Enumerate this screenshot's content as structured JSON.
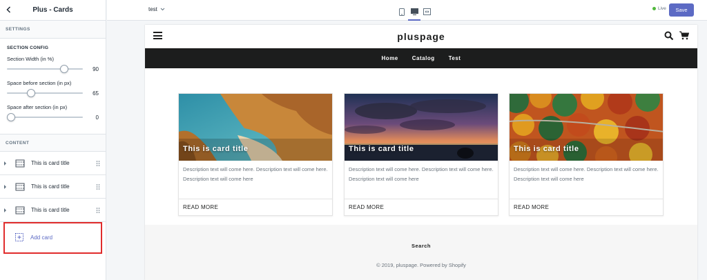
{
  "sidebar": {
    "title": "Plus - Cards",
    "settings_label": "SETTINGS",
    "section_config_label": "SECTION CONFIG",
    "fields": [
      {
        "label": "Section Width (in %)",
        "value": "90",
        "fraction": 0.79
      },
      {
        "label": "Space before section (in px)",
        "value": "65",
        "fraction": 0.3
      },
      {
        "label": "Space after section (in px)",
        "value": "0",
        "fraction": 0.0
      }
    ],
    "content_label": "CONTENT",
    "blocks": [
      {
        "label": "This is card title"
      },
      {
        "label": "This is card title"
      },
      {
        "label": "This is card title"
      }
    ],
    "add_card_label": "Add card"
  },
  "topbar": {
    "theme_name": "test",
    "status": "Live",
    "save_label": "Save",
    "accent_color": "#5c6ac4",
    "status_color": "#50b83c"
  },
  "store": {
    "logo": "pluspage",
    "nav": [
      "Home",
      "Catalog",
      "Test"
    ],
    "cards": [
      {
        "title": "This is card title",
        "description": "Description text will come here. Description text will come here. Description text will come here",
        "button": "READ MORE",
        "image": "beach-cliffs"
      },
      {
        "title": "This is card title",
        "description": "Description text will come here. Description text will come here. Description text will come here",
        "button": "READ MORE",
        "image": "sunset-sea"
      },
      {
        "title": "This is card title",
        "description": "Description text will come here. Description text will come here. Description text will come here",
        "button": "READ MORE",
        "image": "autumn-forest"
      }
    ],
    "footer_link": "Search",
    "copyright": "© 2019, pluspage. Powered by Shopify"
  }
}
